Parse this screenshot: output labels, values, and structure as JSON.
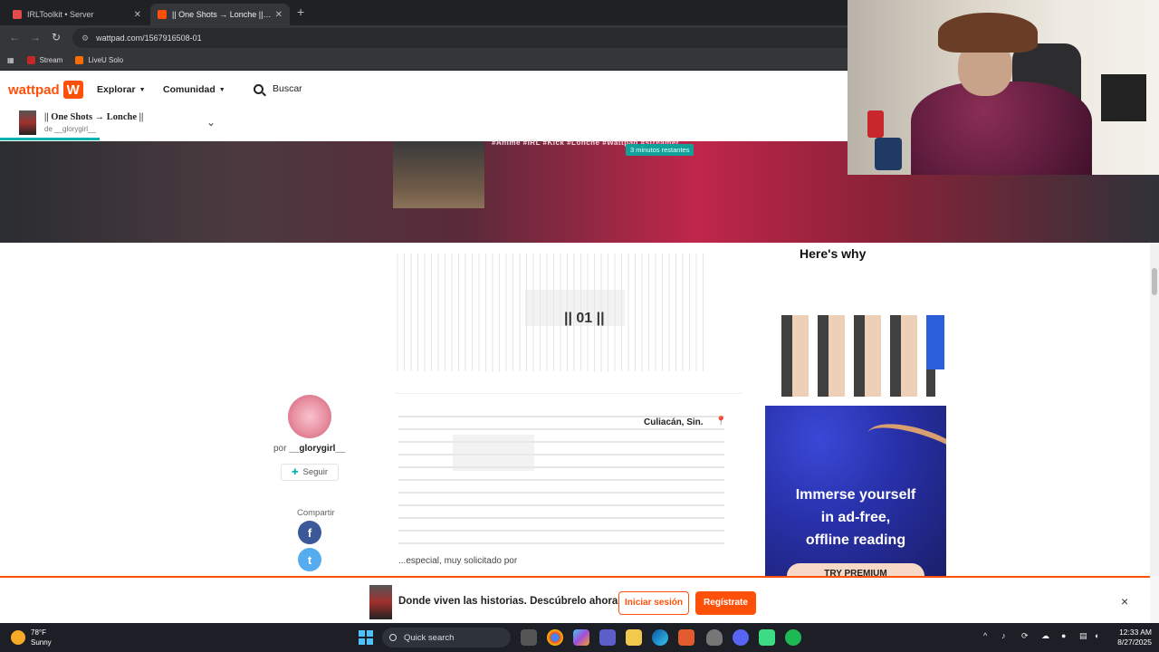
{
  "browser": {
    "tabs": [
      {
        "title": "IRLToolkit • Server",
        "favicon_color": "#e34b4b"
      },
      {
        "title": "|| One Shots → Lonche || - || 01 ||",
        "favicon_color": "#ff500a"
      }
    ],
    "url": "wattpad.com/1567916508-01",
    "bookmarks": [
      {
        "label": "Stream",
        "icon_color": "#c62828"
      },
      {
        "label": "LiveU Solo",
        "icon_color": "#ff6d00"
      }
    ]
  },
  "header": {
    "logo_text": "wattpad",
    "logo_mark": "W",
    "nav": [
      "Explorar",
      "Comunidad"
    ],
    "search_label": "Buscar"
  },
  "story": {
    "title": "|| One Shots → Lonche ||",
    "byline": "de __glorygirl__"
  },
  "hero": {
    "tags": "#Anime  #IRL  #Kick  #Lonche  #Wattpad  #streamer",
    "time_left": "3 minutos restantes"
  },
  "chapter": {
    "number": "|| 01 ||",
    "location": "Culiacán, Sin.",
    "excerpt": "...especial, muy solicitado por"
  },
  "author": {
    "prefix": "por",
    "name": "__glorygirl__",
    "follow_label": "Seguir",
    "share_label": "Compartir",
    "facebook_glyph": "f",
    "twitter_glyph": "t"
  },
  "ads": {
    "top_text": "Here's why",
    "bottom_text_lines": [
      "Immerse yourself",
      "in ad-free,",
      "offline reading"
    ],
    "bottom_button": "TRY PREMIUM"
  },
  "banner": {
    "text": "Donde viven las historias. Descúbrelo ahora",
    "login": "Iniciar sesión",
    "register": "Regístrate",
    "close": "×"
  },
  "taskbar": {
    "temp": "78°F",
    "condition": "Sunny",
    "search_placeholder": "Quick search",
    "time": "12:33 AM",
    "date": "8/27/2025"
  },
  "colors": {
    "brand": "#ff500a",
    "teal": "#00b2b2"
  }
}
